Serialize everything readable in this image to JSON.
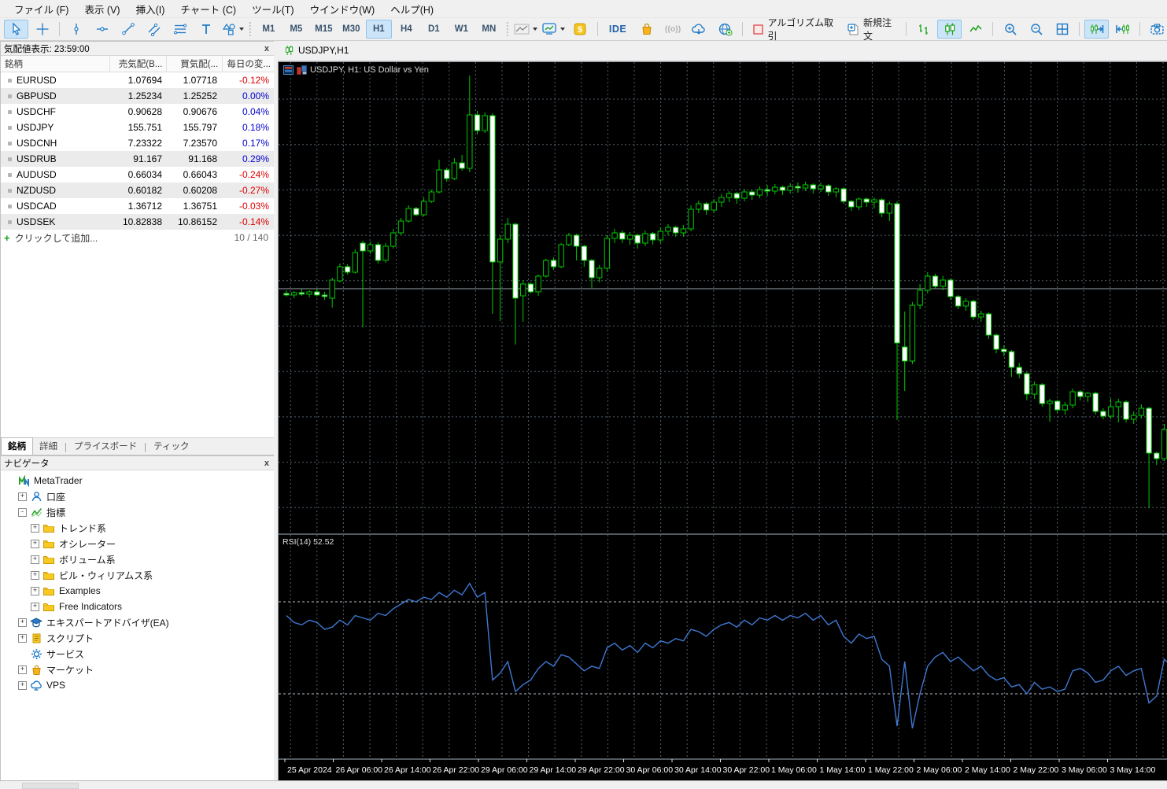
{
  "menu": {
    "items": [
      "ファイル (F)",
      "表示 (V)",
      "挿入(I)",
      "チャート (C)",
      "ツール(T)",
      "ウインドウ(W)",
      "ヘルプ(H)"
    ]
  },
  "toolbar": {
    "standard": [
      {
        "icon": "cursor",
        "name": "cursor-tool",
        "selected": true
      },
      {
        "icon": "crosshair",
        "name": "crosshair-tool"
      },
      {
        "icon": "sep"
      },
      {
        "icon": "vline",
        "name": "vertical-line-tool"
      },
      {
        "icon": "hline",
        "name": "horizontal-line-tool"
      },
      {
        "icon": "trendline",
        "name": "trendline-tool"
      },
      {
        "icon": "channel",
        "name": "channel-tool"
      },
      {
        "icon": "lines",
        "name": "equidistant-lines-tool"
      },
      {
        "icon": "text",
        "name": "text-tool"
      },
      {
        "icon": "shapes",
        "name": "shapes-tool",
        "dropdown": true
      }
    ],
    "timeframes": [
      "M1",
      "M5",
      "M15",
      "M30",
      "H1",
      "H4",
      "D1",
      "W1",
      "MN"
    ],
    "selected_timeframe": "H1",
    "right": [
      {
        "icon": "indicators",
        "name": "indicators-button",
        "dropdown": true
      },
      {
        "icon": "template",
        "name": "chart-template-button",
        "dropdown": true
      },
      {
        "icon": "dollar",
        "name": "trade-button"
      },
      {
        "icon": "sep"
      },
      {
        "icon": "ide",
        "name": "ide-button",
        "label": "IDE"
      },
      {
        "icon": "bag",
        "name": "market-button"
      },
      {
        "icon": "signals",
        "name": "signals-button",
        "disabled": true
      },
      {
        "icon": "cloud",
        "name": "cloud-button"
      },
      {
        "icon": "community",
        "name": "community-button"
      },
      {
        "icon": "sep"
      },
      {
        "icon": "algo",
        "name": "algo-trading-button",
        "label": "アルゴリズム取引"
      },
      {
        "icon": "neworder",
        "name": "new-order-button",
        "label": "新規注文"
      },
      {
        "icon": "sep"
      },
      {
        "icon": "bars",
        "name": "bar-chart-button"
      },
      {
        "icon": "candles",
        "name": "candle-chart-button",
        "selected": true
      },
      {
        "icon": "linechart",
        "name": "line-chart-button"
      },
      {
        "icon": "sep"
      },
      {
        "icon": "zoomin",
        "name": "zoom-in-button"
      },
      {
        "icon": "zoomout",
        "name": "zoom-out-button"
      },
      {
        "icon": "tile",
        "name": "tile-windows-button"
      },
      {
        "icon": "sep"
      },
      {
        "icon": "shiftend",
        "name": "auto-scroll-button",
        "selected": true
      },
      {
        "icon": "shiftleft",
        "name": "chart-shift-button"
      },
      {
        "icon": "sep"
      },
      {
        "icon": "camera",
        "name": "screenshot-button"
      }
    ]
  },
  "market_watch": {
    "title": "気配値表示: 23:59:00",
    "columns": [
      "銘柄",
      "売気配(B...",
      "買気配(...",
      "毎日の変..."
    ],
    "rows": [
      {
        "symbol": "EURUSD",
        "bid": "1.07694",
        "ask": "1.07718",
        "change": "-0.12%",
        "dir": "down",
        "striped": false
      },
      {
        "symbol": "GBPUSD",
        "bid": "1.25234",
        "ask": "1.25252",
        "change": "0.00%",
        "dir": "up",
        "striped": true
      },
      {
        "symbol": "USDCHF",
        "bid": "0.90628",
        "ask": "0.90676",
        "change": "0.04%",
        "dir": "up",
        "striped": false
      },
      {
        "symbol": "USDJPY",
        "bid": "155.751",
        "ask": "155.797",
        "change": "0.18%",
        "dir": "up",
        "striped": false
      },
      {
        "symbol": "USDCNH",
        "bid": "7.23322",
        "ask": "7.23570",
        "change": "0.17%",
        "dir": "up",
        "striped": false
      },
      {
        "symbol": "USDRUB",
        "bid": "91.167",
        "ask": "91.168",
        "change": "0.29%",
        "dir": "up",
        "striped": true
      },
      {
        "symbol": "AUDUSD",
        "bid": "0.66034",
        "ask": "0.66043",
        "change": "-0.24%",
        "dir": "down",
        "striped": false
      },
      {
        "symbol": "NZDUSD",
        "bid": "0.60182",
        "ask": "0.60208",
        "change": "-0.27%",
        "dir": "down",
        "striped": true
      },
      {
        "symbol": "USDCAD",
        "bid": "1.36712",
        "ask": "1.36751",
        "change": "-0.03%",
        "dir": "down",
        "striped": false
      },
      {
        "symbol": "USDSEK",
        "bid": "10.82838",
        "ask": "10.86152",
        "change": "-0.14%",
        "dir": "down",
        "striped": true
      }
    ],
    "add_label": "クリックして追加...",
    "count": "10 / 140",
    "tabs": [
      "銘柄",
      "詳細",
      "プライスボード",
      "ティック"
    ],
    "active_tab": "銘柄"
  },
  "navigator": {
    "title": "ナビゲータ",
    "tree": [
      {
        "label": "MetaTrader",
        "icon": "logo",
        "depth": 0,
        "expander": "none"
      },
      {
        "label": "口座",
        "icon": "accounts",
        "depth": 1,
        "expander": "plus"
      },
      {
        "label": "指標",
        "icon": "indicator",
        "depth": 1,
        "expander": "minus"
      },
      {
        "label": "トレンド系",
        "icon": "folder",
        "depth": 2,
        "expander": "plus"
      },
      {
        "label": "オシレーター",
        "icon": "folder",
        "depth": 2,
        "expander": "plus"
      },
      {
        "label": "ボリューム系",
        "icon": "folder",
        "depth": 2,
        "expander": "plus"
      },
      {
        "label": "ビル・ウィリアムス系",
        "icon": "folder",
        "depth": 2,
        "expander": "plus"
      },
      {
        "label": "Examples",
        "icon": "folder",
        "depth": 2,
        "expander": "plus"
      },
      {
        "label": "Free Indicators",
        "icon": "folder",
        "depth": 2,
        "expander": "plus"
      },
      {
        "label": "エキスパートアドバイザ(EA)",
        "icon": "ea",
        "depth": 1,
        "expander": "plus"
      },
      {
        "label": "スクリプト",
        "icon": "script",
        "depth": 1,
        "expander": "plus"
      },
      {
        "label": "サービス",
        "icon": "service",
        "depth": 1,
        "expander": "none"
      },
      {
        "label": "マーケット",
        "icon": "market",
        "depth": 1,
        "expander": "plus"
      },
      {
        "label": "VPS",
        "icon": "vps",
        "depth": 1,
        "expander": "plus"
      }
    ]
  },
  "chart_window": {
    "tab": "USDJPY,H1",
    "overlay_title": "USDJPY, H1: US Dollar vs Yen",
    "rsi_label": "RSI(14) 52.52"
  },
  "chart_data": {
    "type": "candlestick",
    "symbol": "USDJPY",
    "timeframe": "H1",
    "title": "USDJPY, H1: US Dollar vs Yen",
    "price_axis_visible": false,
    "assumed_price_range": [
      151.9,
      160.7
    ],
    "price_line": 157.84,
    "x_labels": [
      "25 Apr 2024",
      "26 Apr 06:00",
      "26 Apr 14:00",
      "26 Apr 22:00",
      "29 Apr 06:00",
      "29 Apr 14:00",
      "29 Apr 22:00",
      "30 Apr 06:00",
      "30 Apr 14:00",
      "30 Apr 22:00",
      "1 May 06:00",
      "1 May 14:00",
      "1 May 22:00",
      "2 May 06:00",
      "2 May 14:00",
      "2 May 22:00",
      "3 May 06:00",
      "3 May 14:00"
    ],
    "colors": {
      "background": "#000000",
      "grid": "#515d68",
      "candle": "#00c800",
      "bull_body": "#000000",
      "bear_body": "#ffffff",
      "rsi_line": "#3f78d1",
      "price_line": "#9aa3ab"
    },
    "candles": [
      [
        157.78,
        157.82,
        157.74,
        157.76
      ],
      [
        157.76,
        157.81,
        157.72,
        157.79
      ],
      [
        157.79,
        157.84,
        157.75,
        157.77
      ],
      [
        157.77,
        157.82,
        157.73,
        157.8
      ],
      [
        157.8,
        157.84,
        157.74,
        157.76
      ],
      [
        157.76,
        157.8,
        157.7,
        157.74
      ],
      [
        157.72,
        157.98,
        157.6,
        157.95
      ],
      [
        157.94,
        158.16,
        157.92,
        158.12
      ],
      [
        158.12,
        158.15,
        158.02,
        158.05
      ],
      [
        158.05,
        158.34,
        158.03,
        158.3
      ],
      [
        158.42,
        158.45,
        157.35,
        158.32
      ],
      [
        158.32,
        158.44,
        158.28,
        158.4
      ],
      [
        158.4,
        158.43,
        158.16,
        158.2
      ],
      [
        158.2,
        158.42,
        158.17,
        158.38
      ],
      [
        158.38,
        158.6,
        158.35,
        158.55
      ],
      [
        158.55,
        158.74,
        158.52,
        158.7
      ],
      [
        158.7,
        158.9,
        158.68,
        158.86
      ],
      [
        158.86,
        158.88,
        158.76,
        158.78
      ],
      [
        158.78,
        159.0,
        158.76,
        158.95
      ],
      [
        158.95,
        159.1,
        158.93,
        159.07
      ],
      [
        159.07,
        159.48,
        159.05,
        159.35
      ],
      [
        159.35,
        159.38,
        159.2,
        159.24
      ],
      [
        159.24,
        159.5,
        159.22,
        159.44
      ],
      [
        159.44,
        159.54,
        159.34,
        159.37
      ],
      [
        159.37,
        160.55,
        159.32,
        160.05
      ],
      [
        160.05,
        160.1,
        159.8,
        159.85
      ],
      [
        159.85,
        160.08,
        159.82,
        160.04
      ],
      [
        160.04,
        160.07,
        157.52,
        158.18
      ],
      [
        158.18,
        158.52,
        157.43,
        158.47
      ],
      [
        158.47,
        158.74,
        158.42,
        158.66
      ],
      [
        158.66,
        158.68,
        157.13,
        157.72
      ],
      [
        157.75,
        157.95,
        157.42,
        157.9
      ],
      [
        157.9,
        157.92,
        157.78,
        157.8
      ],
      [
        157.8,
        158.02,
        157.75,
        158.0
      ],
      [
        158.0,
        158.22,
        157.98,
        158.2
      ],
      [
        158.2,
        158.24,
        158.08,
        158.12
      ],
      [
        158.12,
        158.42,
        158.1,
        158.4
      ],
      [
        158.4,
        158.55,
        158.38,
        158.52
      ],
      [
        158.52,
        158.54,
        158.2,
        158.38
      ],
      [
        158.38,
        158.4,
        158.12,
        158.2
      ],
      [
        158.2,
        158.22,
        157.85,
        157.98
      ],
      [
        157.98,
        158.14,
        157.92,
        158.1
      ],
      [
        158.1,
        158.52,
        158.06,
        158.48
      ],
      [
        158.48,
        158.6,
        158.42,
        158.55
      ],
      [
        158.55,
        158.58,
        158.42,
        158.47
      ],
      [
        158.47,
        158.56,
        158.4,
        158.52
      ],
      [
        158.52,
        158.54,
        158.35,
        158.42
      ],
      [
        158.42,
        158.58,
        158.38,
        158.54
      ],
      [
        158.54,
        158.56,
        158.4,
        158.46
      ],
      [
        158.46,
        158.62,
        158.42,
        158.57
      ],
      [
        158.57,
        158.66,
        158.52,
        158.62
      ],
      [
        158.62,
        158.64,
        158.5,
        158.55
      ],
      [
        158.55,
        158.65,
        158.5,
        158.6
      ],
      [
        158.6,
        158.9,
        158.57,
        158.85
      ],
      [
        158.85,
        158.96,
        158.8,
        158.92
      ],
      [
        158.92,
        158.94,
        158.78,
        158.84
      ],
      [
        158.84,
        158.98,
        158.8,
        158.94
      ],
      [
        158.94,
        159.04,
        158.88,
        159.0
      ],
      [
        159.0,
        159.08,
        158.94,
        159.05
      ],
      [
        159.05,
        159.07,
        158.92,
        158.99
      ],
      [
        158.99,
        159.11,
        158.95,
        159.07
      ],
      [
        159.07,
        159.1,
        158.97,
        159.03
      ],
      [
        159.03,
        159.14,
        158.99,
        159.1
      ],
      [
        159.1,
        159.16,
        159.02,
        159.08
      ],
      [
        159.08,
        159.17,
        159.04,
        159.13
      ],
      [
        159.13,
        159.15,
        159.03,
        159.09
      ],
      [
        159.09,
        159.18,
        159.05,
        159.14
      ],
      [
        159.14,
        159.19,
        159.06,
        159.12
      ],
      [
        159.12,
        159.2,
        159.08,
        159.16
      ],
      [
        159.16,
        159.18,
        159.05,
        159.11
      ],
      [
        159.11,
        159.19,
        159.07,
        159.15
      ],
      [
        159.15,
        159.17,
        159.02,
        159.07
      ],
      [
        159.07,
        159.13,
        159.0,
        159.11
      ],
      [
        159.11,
        159.13,
        158.92,
        158.95
      ],
      [
        158.95,
        158.97,
        158.83,
        158.88
      ],
      [
        158.88,
        159.0,
        158.84,
        158.98
      ],
      [
        158.98,
        159.0,
        158.88,
        158.94
      ],
      [
        158.94,
        159.0,
        158.86,
        158.97
      ],
      [
        158.97,
        158.99,
        158.75,
        158.8
      ],
      [
        158.8,
        158.95,
        158.7,
        158.92
      ],
      [
        158.92,
        158.95,
        156.17,
        157.15
      ],
      [
        157.1,
        157.55,
        156.54,
        156.92
      ],
      [
        156.92,
        157.67,
        156.88,
        157.63
      ],
      [
        157.63,
        157.9,
        157.58,
        157.82
      ],
      [
        157.82,
        158.05,
        157.78,
        158.0
      ],
      [
        158.0,
        158.03,
        157.84,
        157.87
      ],
      [
        157.87,
        158.0,
        157.82,
        157.95
      ],
      [
        157.95,
        157.97,
        157.7,
        157.74
      ],
      [
        157.74,
        157.76,
        157.58,
        157.62
      ],
      [
        157.62,
        157.72,
        157.56,
        157.68
      ],
      [
        157.68,
        157.7,
        157.44,
        157.48
      ],
      [
        157.48,
        157.56,
        157.42,
        157.52
      ],
      [
        157.52,
        157.54,
        157.2,
        157.25
      ],
      [
        157.25,
        157.27,
        157.02,
        157.07
      ],
      [
        157.07,
        157.12,
        156.98,
        157.04
      ],
      [
        157.04,
        157.06,
        156.72,
        156.84
      ],
      [
        156.84,
        156.9,
        156.7,
        156.76
      ],
      [
        156.76,
        156.78,
        156.42,
        156.5
      ],
      [
        156.5,
        156.66,
        156.44,
        156.62
      ],
      [
        156.62,
        156.64,
        156.34,
        156.38
      ],
      [
        156.38,
        156.44,
        156.15,
        156.41
      ],
      [
        156.41,
        156.43,
        156.26,
        156.3
      ],
      [
        156.3,
        156.4,
        156.24,
        156.36
      ],
      [
        156.36,
        156.57,
        156.32,
        156.53
      ],
      [
        156.53,
        156.55,
        156.42,
        156.47
      ],
      [
        156.47,
        156.53,
        156.4,
        156.51
      ],
      [
        156.51,
        156.53,
        156.24,
        156.28
      ],
      [
        156.28,
        156.32,
        156.18,
        156.22
      ],
      [
        156.22,
        156.45,
        156.18,
        156.34
      ],
      [
        156.34,
        156.44,
        156.14,
        156.4
      ],
      [
        156.4,
        156.42,
        156.14,
        156.18
      ],
      [
        156.18,
        156.28,
        156.12,
        156.23
      ],
      [
        156.23,
        156.37,
        156.19,
        156.32
      ],
      [
        156.32,
        156.34,
        155.05,
        155.75
      ],
      [
        155.75,
        155.77,
        155.6,
        155.68
      ],
      [
        155.68,
        156.12,
        155.65,
        156.05
      ],
      [
        156.05,
        156.1,
        155.95,
        156.0
      ]
    ],
    "rsi": {
      "period": 14,
      "current": 52.52,
      "levels": [
        70,
        30
      ],
      "values": [
        64,
        61,
        60,
        62,
        61,
        58,
        59,
        62,
        60,
        64,
        63,
        62,
        65,
        64,
        67,
        69,
        71,
        70,
        72,
        71,
        74,
        72,
        75,
        73,
        78,
        72,
        74,
        36,
        39,
        44,
        31,
        34,
        36,
        41,
        44,
        42,
        47,
        46,
        43,
        40,
        42,
        41,
        50,
        52,
        49,
        51,
        48,
        52,
        50,
        53,
        52,
        54,
        53,
        58,
        57,
        55,
        58,
        60,
        61,
        59,
        62,
        60,
        63,
        62,
        64,
        62,
        64,
        63,
        65,
        62,
        64,
        60,
        62,
        55,
        52,
        56,
        54,
        55,
        45,
        42,
        16,
        44,
        15,
        30,
        42,
        46,
        48,
        44,
        46,
        43,
        40,
        42,
        38,
        36,
        37,
        33,
        34,
        30,
        35,
        32,
        33,
        31,
        32,
        40,
        41,
        39,
        35,
        36,
        40,
        42,
        38,
        40,
        41,
        26,
        29,
        45,
        42
      ]
    }
  }
}
